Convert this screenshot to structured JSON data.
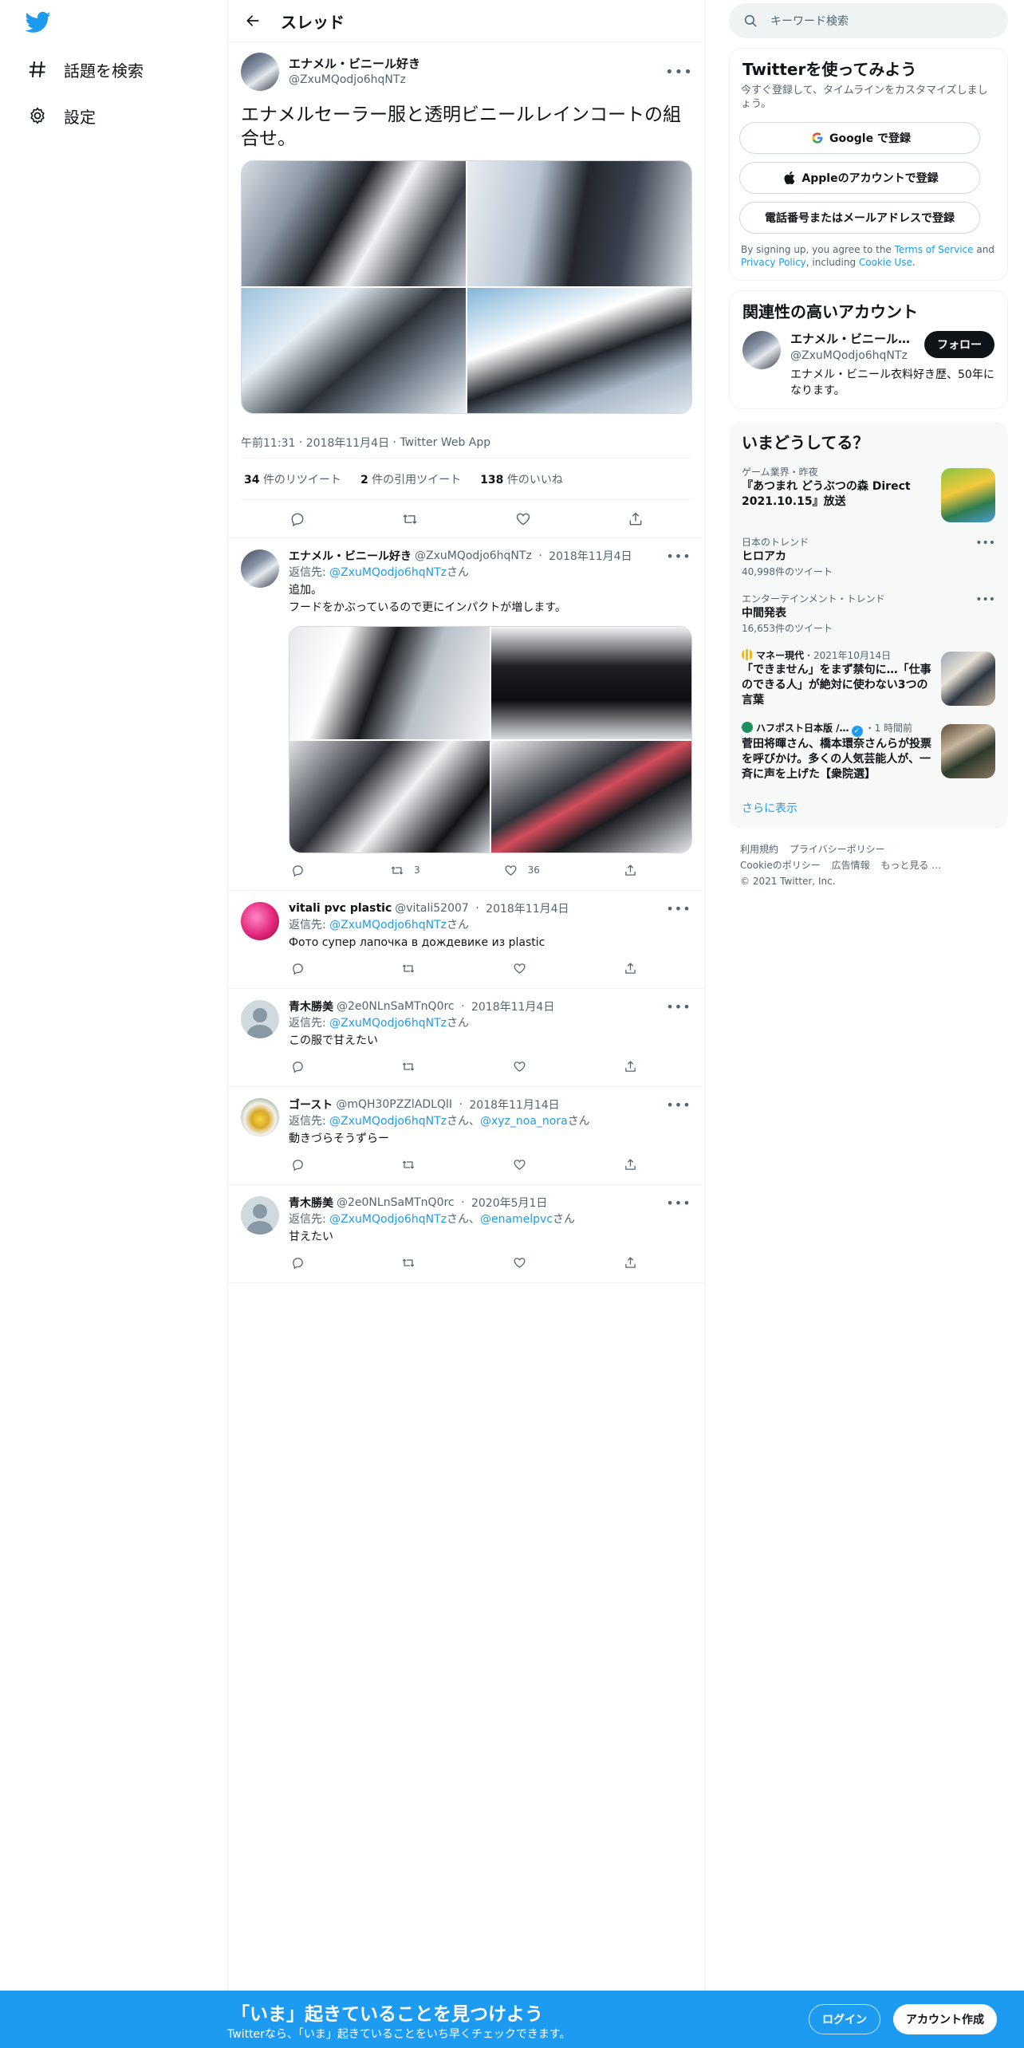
{
  "nav": {
    "explore_label": "話題を検索",
    "settings_label": "設定"
  },
  "header": {
    "back_icon": "arrow-left-icon",
    "title": "スレッド"
  },
  "main_tweet": {
    "name": "エナメル・ビニール好き",
    "handle": "@ZxuMQodjo6hqNTz",
    "text": "エナメルセーラー服と透明ビニールレインコートの組合せ。",
    "time": "午前11:31",
    "date": "2018年11月4日",
    "source": "Twitter Web App",
    "retweets_count": "34",
    "retweets_label": "件のリツイート",
    "quotes_count": "2",
    "quotes_label": "件の引用ツイート",
    "likes_count": "138",
    "likes_label": "件のいいね"
  },
  "replies": [
    {
      "name": "エナメル・ビニール好き",
      "handle": "@ZxuMQodjo6hqNTz",
      "date": "2018年11月4日",
      "replyto_prefix": "返信先: ",
      "replyto_user": "@ZxuMQodjo6hqNTz",
      "replyto_suffix": "さん",
      "text_line1": "追加。",
      "text_line2": "フードをかぶっているので更にインパクトが増します。",
      "retweets": "3",
      "likes": "36"
    },
    {
      "name": "vitali pvc plastic",
      "handle": "@vitali52007",
      "date": "2018年11月4日",
      "replyto_prefix": "返信先: ",
      "replyto_user": "@ZxuMQodjo6hqNTz",
      "replyto_suffix": "さん",
      "text": "Фото супер лапочка в дождевике из plastic"
    },
    {
      "name": "青木勝美",
      "handle": "@2e0NLnSaMTnQ0rc",
      "date": "2018年11月4日",
      "replyto_prefix": "返信先: ",
      "replyto_user": "@ZxuMQodjo6hqNTz",
      "replyto_suffix": "さん",
      "text": "この服で甘えたい"
    },
    {
      "name": "ゴースト",
      "handle": "@mQH30PZZlADLQlI",
      "date": "2018年11月14日",
      "replyto_prefix": "返信先: ",
      "replyto_user": "@ZxuMQodjo6hqNTz",
      "replyto_mid": "さん、",
      "replyto_user2": "@xyz_noa_nora",
      "replyto_suffix": "さん",
      "text": "動きづらそうずらー"
    },
    {
      "name": "青木勝美",
      "handle": "@2e0NLnSaMTnQ0rc",
      "date": "2020年5月1日",
      "replyto_prefix": "返信先: ",
      "replyto_user": "@ZxuMQodjo6hqNTz",
      "replyto_mid": "さん、",
      "replyto_user2": "@enamelpvc",
      "replyto_suffix": "さん",
      "text": "甘えたい"
    }
  ],
  "right": {
    "search_placeholder": "キーワード検索",
    "signup": {
      "title": "Twitterを使ってみよう",
      "desc": "今すぐ登録して、タイムラインをカスタマイズしましょう。",
      "google": "Google で登録",
      "apple": "Appleのアカウントで登録",
      "phone": "電話番号またはメールアドレスで登録",
      "legal_pre": "By signing up, you agree to the ",
      "terms": "Terms of Service",
      "legal_and": " and ",
      "privacy": "Privacy Policy",
      "legal_inc": ", including ",
      "cookie": "Cookie Use",
      "legal_end": "."
    },
    "related": {
      "title": "関連性の高いアカウント",
      "name": "エナメル・ビニール好き",
      "handle": "@ZxuMQodjo6hqNTz",
      "follow": "フォロー",
      "bio": "エナメル・ビニール衣料好き歴、50年になります。"
    },
    "trends": {
      "title": "いまどうしてる？",
      "items": [
        {
          "meta": "ゲーム業界・昨夜",
          "title": "『あつまれ どうぶつの森 Direct 2021.10.15』放送"
        },
        {
          "meta": "日本のトレンド",
          "title": "ヒロアカ",
          "count": "40,998件のツイート"
        },
        {
          "meta": "エンターテインメント・トレンド",
          "title": "中間発表",
          "count": "16,653件のツイート"
        },
        {
          "source": "マネー現代",
          "meta": "・2021年10月14日",
          "title": "「できません」をまず禁句に…「仕事のできる人」が絶対に使わない3つの言葉"
        },
        {
          "source": "ハフポスト日本版 /…",
          "meta": "・1 時間前",
          "title": "菅田将暉さん、橋本環奈さんらが投票を呼びかけ。多くの人気芸能人が、一斉に声を上げた【衆院選】"
        }
      ],
      "show_more": "さらに表示"
    },
    "footer": {
      "links": [
        "利用規約",
        "プライバシーポリシー",
        "Cookieのポリシー",
        "広告情報",
        "もっと見る …"
      ],
      "copyright": "© 2021 Twitter, Inc."
    }
  },
  "bottom": {
    "title": "「いま」起きていることを見つけよう",
    "subtitle": "Twitterなら、「いま」起きていることをいち早くチェックできます。",
    "login": "ログイン",
    "signup": "アカウント作成"
  },
  "colors": {
    "accent": "#1d9bf0",
    "text": "#0f1419",
    "muted": "#536471",
    "border": "#eff3f4"
  }
}
